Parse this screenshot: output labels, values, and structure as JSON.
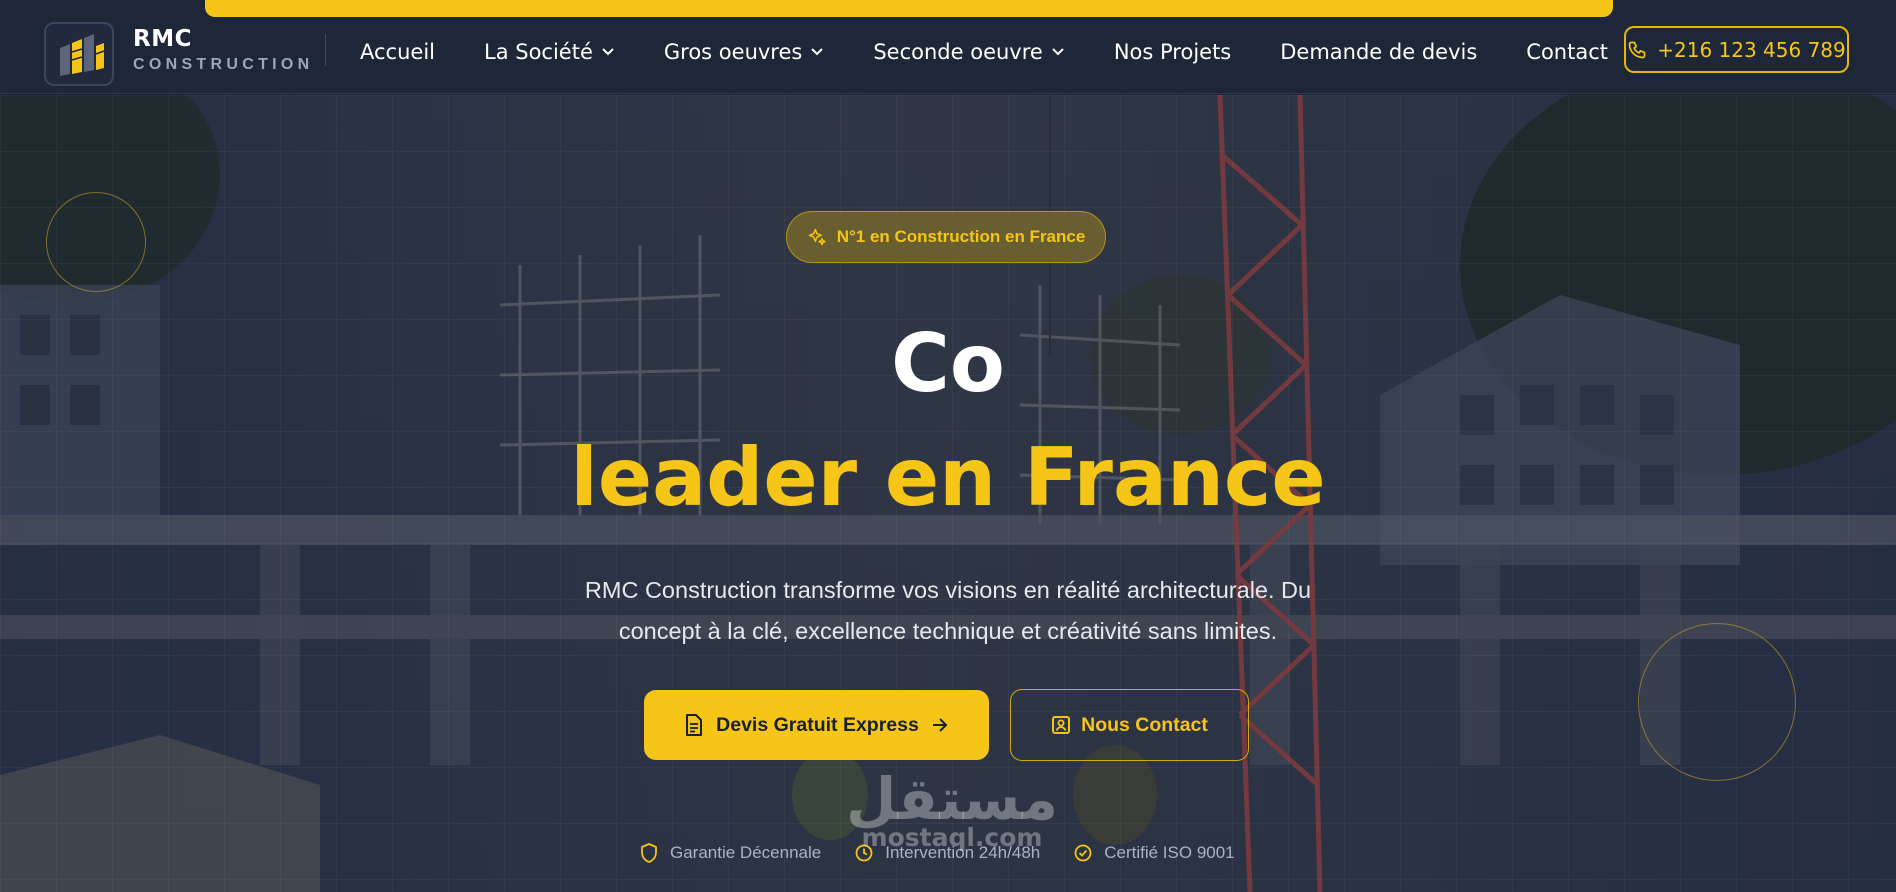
{
  "header": {
    "brand_name": "RMC",
    "brand_sub": "CONSTRUCTION",
    "logo_icon": "building-logo-icon",
    "nav": [
      {
        "label": "Accueil",
        "dropdown": false
      },
      {
        "label": "La Société",
        "dropdown": true
      },
      {
        "label": "Gros oeuvres",
        "dropdown": true
      },
      {
        "label": "Seconde oeuvre",
        "dropdown": true
      },
      {
        "label": "Nos Projets",
        "dropdown": false
      },
      {
        "label": "Demande de devis",
        "dropdown": false
      },
      {
        "label": "Contact",
        "dropdown": false
      }
    ],
    "phone": "+216 123 456 789",
    "phone_icon": "phone-icon"
  },
  "hero": {
    "badge": "N°1 en Construction en France",
    "badge_icon": "sparkles-icon",
    "title_line1": "Co",
    "title_line2": "leader en France",
    "lead": "RMC Construction transforme vos visions en réalité architecturale. Du concept à la clé, excellence technique et créativité sans limites.",
    "cta_primary": "Devis Gratuit Express",
    "cta_secondary": "Nous Contact",
    "features": [
      {
        "label": "Garantie Décennale",
        "icon": "shield-icon"
      },
      {
        "label": "Intervention 24h/48h",
        "icon": "clock-icon"
      },
      {
        "label": "Certifié ISO 9001",
        "icon": "check-circle-icon"
      }
    ]
  },
  "watermark": {
    "arabic": "مستقل",
    "latin": "mostaql.com"
  },
  "colors": {
    "accent": "#f5c518",
    "header_bg": "#1e2738",
    "hero_overlay": "#222c42"
  }
}
